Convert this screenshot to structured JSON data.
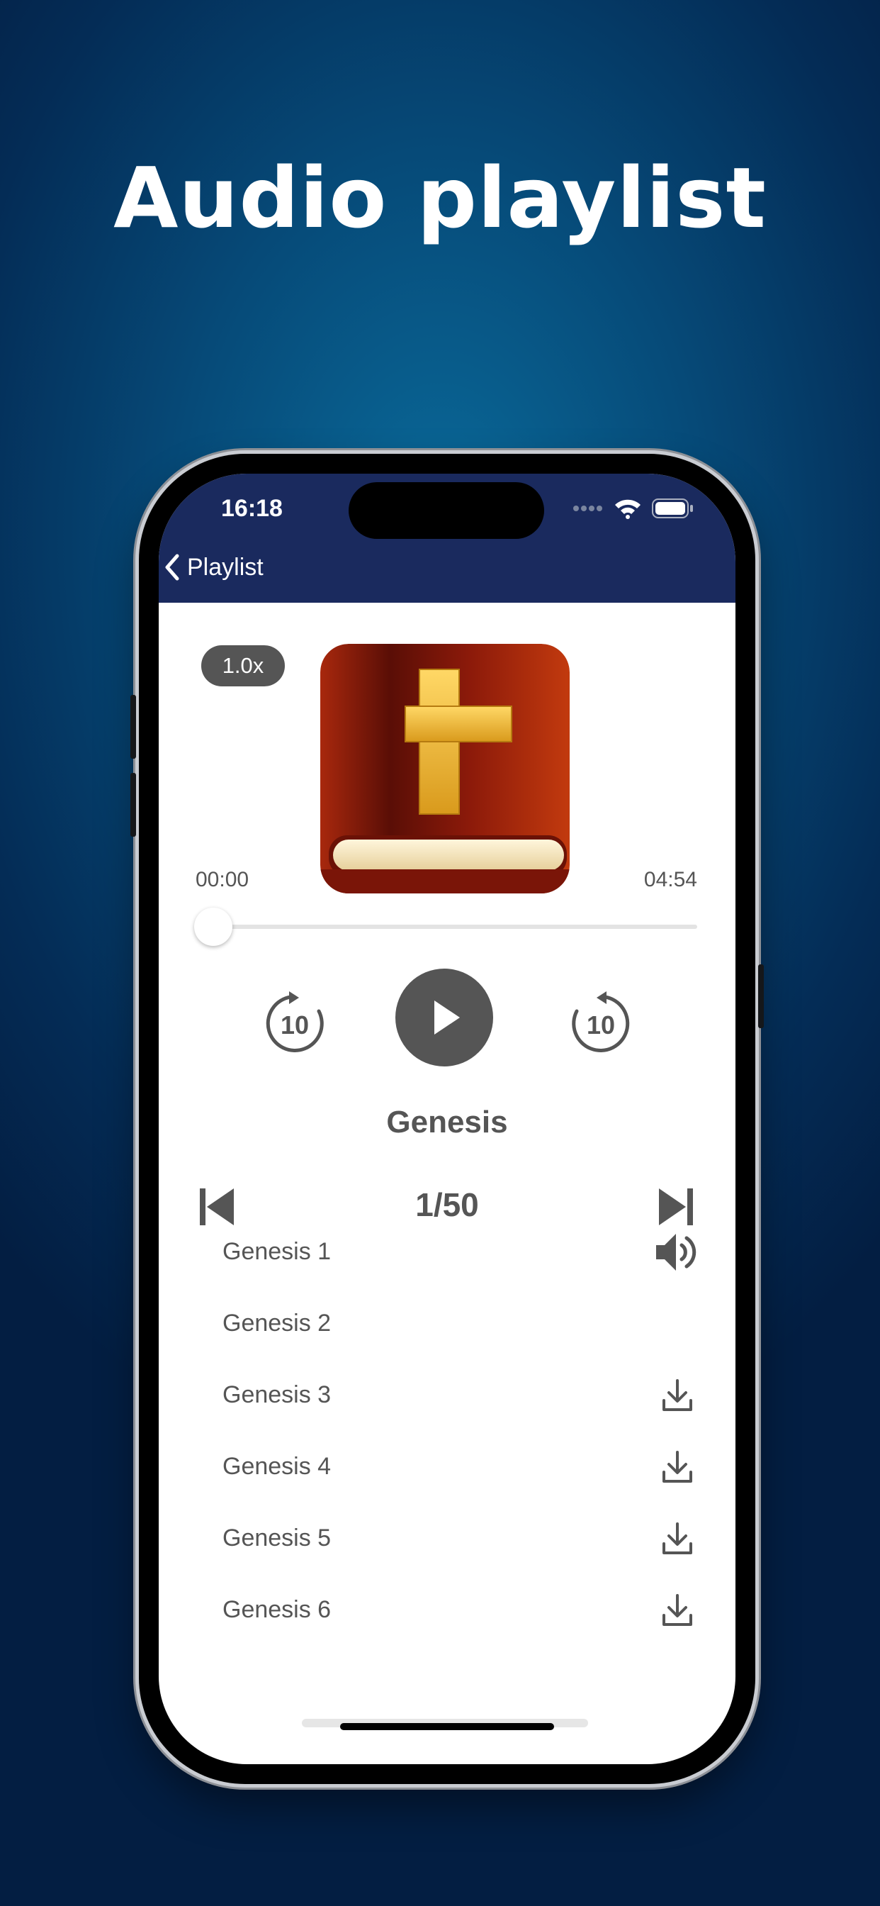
{
  "headline": "Audio playlist",
  "status_bar": {
    "time": "16:18"
  },
  "nav": {
    "back_label": "Playlist"
  },
  "player": {
    "speed": "1.0x",
    "elapsed": "00:00",
    "duration": "04:54",
    "progress": 0,
    "skip_back_seconds": "10",
    "skip_forward_seconds": "10",
    "book_title": "Genesis",
    "chapter_counter": "1/50"
  },
  "playlist": [
    {
      "label": "Genesis 1",
      "icon": "speaker-icon"
    },
    {
      "label": "Genesis 2",
      "icon": ""
    },
    {
      "label": "Genesis 3",
      "icon": "download-icon"
    },
    {
      "label": "Genesis 4",
      "icon": "download-icon"
    },
    {
      "label": "Genesis 5",
      "icon": "download-icon"
    },
    {
      "label": "Genesis 6",
      "icon": "download-icon"
    }
  ],
  "colors": {
    "nav_background": "#1a2a5e",
    "control_gray": "#555555",
    "background_top": "#0a6a9a",
    "background_bottom": "#031e42"
  }
}
